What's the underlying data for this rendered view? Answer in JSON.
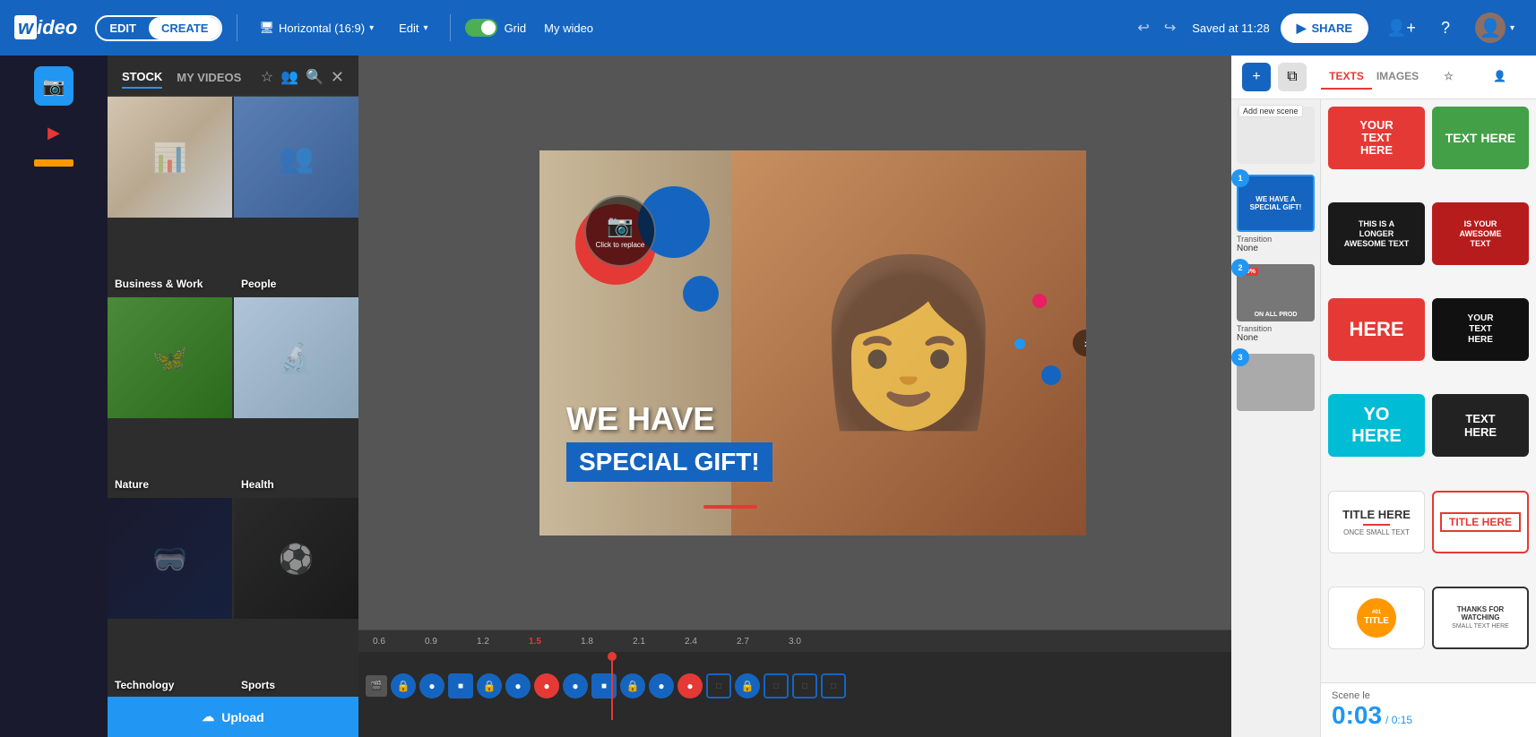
{
  "app": {
    "name": "wideo",
    "mode": "editor"
  },
  "topnav": {
    "edit_label": "EDIT",
    "create_label": "CREATE",
    "format_label": "Horizontal (16:9)",
    "edit_menu_label": "Edit",
    "grid_label": "Grid",
    "project_name": "My wideo",
    "saved_text": "Saved at 11:28",
    "share_label": "SHARE",
    "undo_icon": "↩",
    "redo_icon": "↪"
  },
  "left_sidebar": {
    "icons": [
      {
        "name": "camera-icon",
        "symbol": "📷",
        "active": true
      },
      {
        "name": "video-icon",
        "symbol": "▶"
      },
      {
        "name": "shapes-icon",
        "symbol": "🔶"
      }
    ]
  },
  "stock_panel": {
    "tabs": [
      {
        "label": "STOCK",
        "active": true
      },
      {
        "label": "MY VIDEOS",
        "active": false
      }
    ],
    "categories": [
      {
        "label": "Business & Work",
        "color": "#b8a89a"
      },
      {
        "label": "People",
        "color": "#5a7fb5"
      },
      {
        "label": "Nature",
        "color": "#4a7a3a"
      },
      {
        "label": "Health",
        "color": "#b0c4d8"
      },
      {
        "label": "Technology",
        "color": "#1a1a2e"
      },
      {
        "label": "Sports",
        "color": "#2a2a2a"
      }
    ],
    "upload_label": "Upload",
    "upload_icon": "☁"
  },
  "canvas": {
    "headline1": "WE HAVE",
    "headline2": "SPECIAL GIFT!",
    "camera_label": "Click to replace",
    "next_icon": "›"
  },
  "timeline": {
    "markers": [
      "0.6",
      "0.9",
      "1.2",
      "1.5",
      "1.8",
      "2.1",
      "2.4",
      "2.7",
      "3.0"
    ],
    "playhead_position": "1.5"
  },
  "right_panel": {
    "add_scene_label": "Add new scene",
    "tabs": [
      {
        "label": "TEXTS",
        "active": true
      },
      {
        "label": "IMAGES",
        "active": false
      },
      {
        "label": "FAVORITES",
        "active": false
      },
      {
        "label": "AVATARS",
        "active": false
      }
    ],
    "scenes": [
      {
        "number": "1",
        "text": "WE HAVE A SPECIAL GIFT!",
        "transition": "Transition",
        "transition_value": "None",
        "selected": true
      },
      {
        "number": "2",
        "text": "50% ON ALL PROD",
        "transition": "Transition",
        "transition_value": "None",
        "selected": false
      },
      {
        "number": "3",
        "text": "",
        "transition": "",
        "transition_value": "",
        "selected": false
      }
    ],
    "scene_length_label": "Scene le",
    "scene_length_time": "0:03",
    "scene_length_divider": "/",
    "scene_length_total": "0:15",
    "templates": [
      {
        "bg": "#e53935",
        "text": "YOUR TEXT HERE",
        "style": "light"
      },
      {
        "bg": "#43a047",
        "text": "TEXT HERE",
        "style": "light"
      },
      {
        "bg": "#1a1a1a",
        "text": "THIS IS A LONGER AWESOME TEXT",
        "style": "light"
      },
      {
        "bg": "#b71c1c",
        "text": "IS YOUR AWESOME TEXT",
        "style": "light"
      },
      {
        "bg": "#e53935",
        "text": "HERE",
        "style": "light"
      },
      {
        "bg": "#1565c0",
        "text": "YOUR TEXT HERE",
        "style": "light"
      },
      {
        "bg": "#00bcd4",
        "text": "YO HERE",
        "style": "light"
      },
      {
        "bg": "#1a1a1a",
        "text": "TEXT HERE",
        "style": "light"
      },
      {
        "bg": "white",
        "text": "TITLE HERE\nONCE SMALL TEXT",
        "style": "dark"
      },
      {
        "bg": "white",
        "text": "TITLE HERE",
        "style": "dark_outline"
      },
      {
        "bg": "orange_circle",
        "text": "#01 TITLE",
        "style": "circle"
      },
      {
        "bg": "white",
        "text": "THANKS FOR WATCHING\nSMALL TEXT HERE",
        "style": "dark_border"
      }
    ]
  }
}
